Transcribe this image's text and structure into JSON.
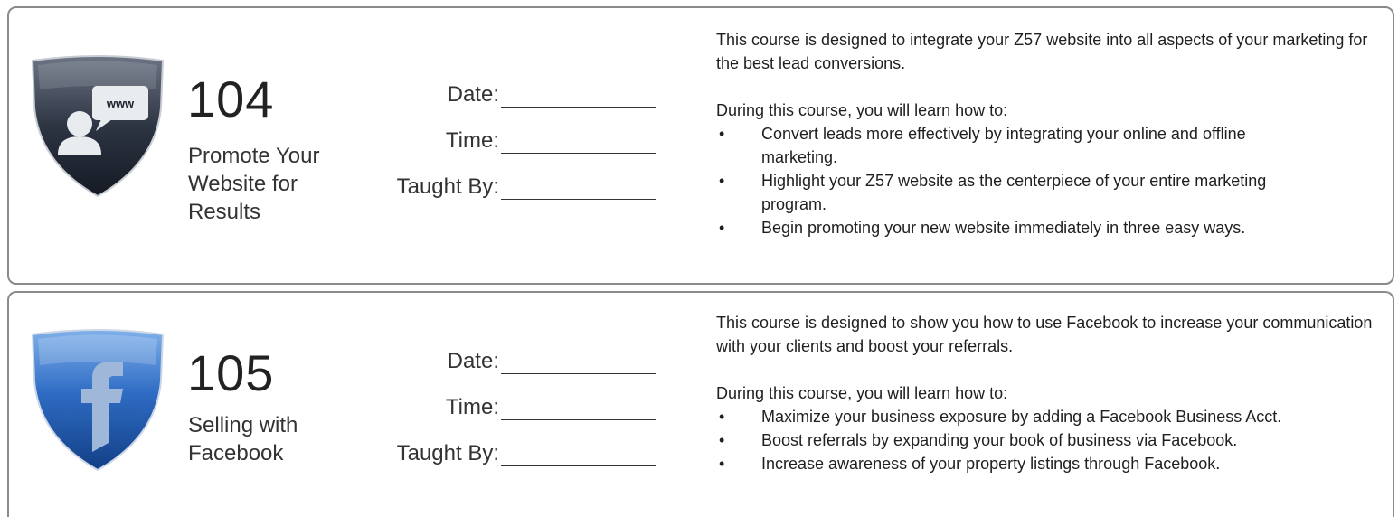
{
  "courses": [
    {
      "icon": "www-user-shield-icon",
      "number": "104",
      "title": "Promote Your Website for Results",
      "fields": [
        {
          "label": "Date:"
        },
        {
          "label": "Time:"
        },
        {
          "label": "Taught By:"
        }
      ],
      "description": "This course is designed to integrate your Z57 website into all aspects of your marketing for the best lead conversions.",
      "learn_intro": "During this course, you will learn how to:",
      "bullets": [
        "Convert leads more effectively by integrating your online and offline marketing.",
        "Highlight your Z57 website as the centerpiece of your entire marketing program.",
        "Begin promoting your new website immediately in three easy ways."
      ],
      "colors": {
        "shield": "#2e3545"
      }
    },
    {
      "icon": "facebook-shield-icon",
      "number": "105",
      "title": "Selling with Facebook",
      "fields": [
        {
          "label": "Date:"
        },
        {
          "label": "Time:"
        },
        {
          "label": "Taught By:"
        }
      ],
      "description": "This course is designed to show you how to use Facebook to increase your communication with your clients and boost your referrals.",
      "learn_intro": "During this course, you will learn how to:",
      "bullets": [
        "Maximize your business exposure by adding a Facebook Business Acct.",
        "Boost referrals by expanding your book of business via Facebook.",
        "Increase awareness of your property listings through Facebook."
      ],
      "colors": {
        "shield": "#2a62b8"
      }
    }
  ]
}
